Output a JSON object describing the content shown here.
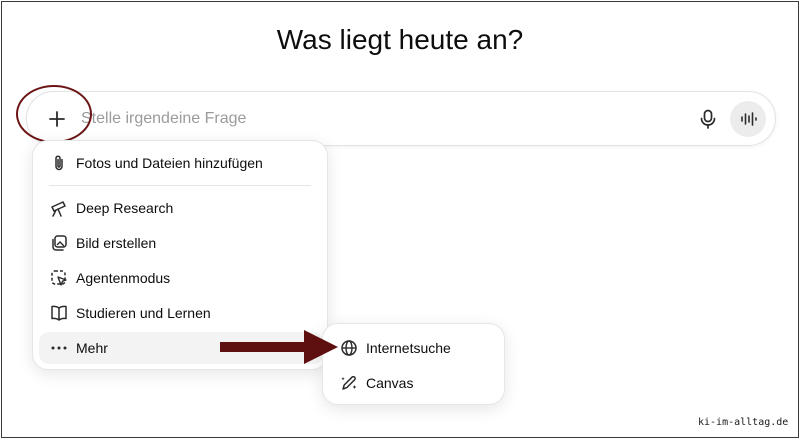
{
  "heading": "Was liegt heute an?",
  "composer": {
    "placeholder": "Stelle irgendeine Frage",
    "plus_icon": "plus-icon",
    "mic_icon": "microphone-icon",
    "voice_icon": "voice-mode-icon"
  },
  "menu": {
    "items": [
      {
        "label": "Fotos und Dateien hinzufügen",
        "icon": "paperclip-icon"
      },
      {
        "label": "Deep Research",
        "icon": "telescope-icon"
      },
      {
        "label": "Bild erstellen",
        "icon": "image-create-icon"
      },
      {
        "label": "Agentenmodus",
        "icon": "agent-cursor-icon"
      },
      {
        "label": "Studieren und Lernen",
        "icon": "book-icon"
      },
      {
        "label": "Mehr",
        "icon": "more-dots-icon"
      }
    ]
  },
  "submenu": {
    "items": [
      {
        "label": "Internetsuche",
        "icon": "globe-icon"
      },
      {
        "label": "Canvas",
        "icon": "canvas-pen-icon"
      }
    ]
  },
  "annotation": {
    "ring_color": "#6b1414",
    "arrow_color": "#5e0f0f"
  },
  "watermark": "ki-im-alltag.de"
}
